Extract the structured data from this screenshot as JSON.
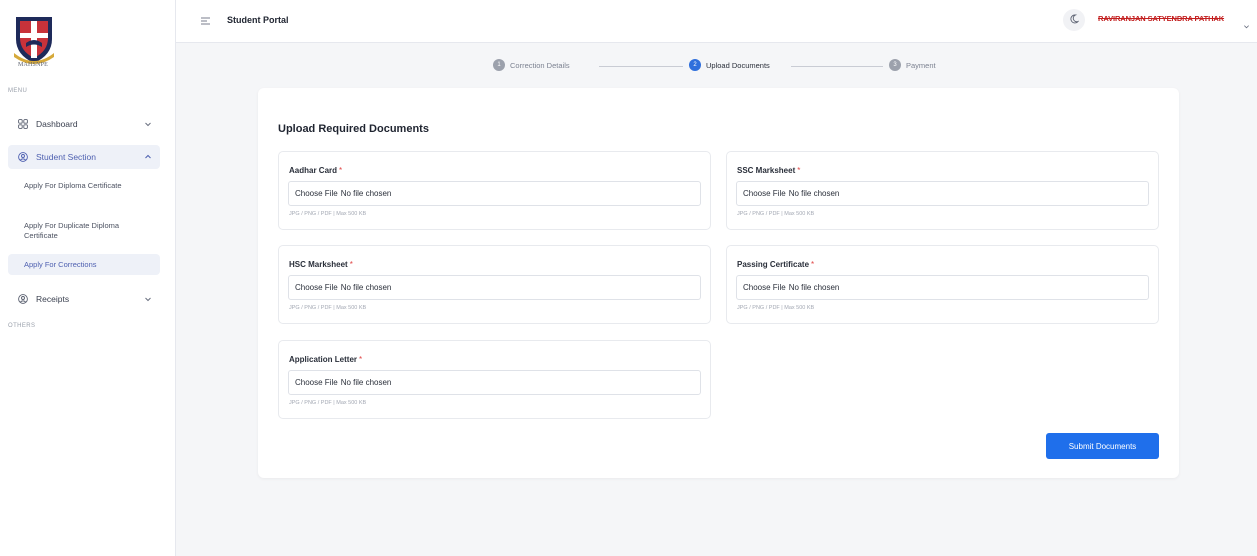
{
  "brand": {
    "logo_caption": "MAHSNPE"
  },
  "sidebar": {
    "menu_label": "MENU",
    "others_label": "OTHERS",
    "items": [
      {
        "label": "Dashboard",
        "icon": "grid-icon"
      },
      {
        "label": "Student Section",
        "icon": "user-circle-icon"
      },
      {
        "label": "Receipts",
        "icon": "receipt-icon"
      }
    ],
    "student_sub_items": [
      {
        "label": "Apply For Diploma Certificate"
      },
      {
        "label": "Apply For Duplicate Diploma Certificate"
      },
      {
        "label": "Apply For Corrections"
      }
    ]
  },
  "header": {
    "title": "Student Portal",
    "user_name": "RAVIRANJAN SATYENDRA PATHAK"
  },
  "stepper": {
    "steps": [
      {
        "number": "1",
        "label": "Correction Details"
      },
      {
        "number": "2",
        "label": "Upload Documents"
      },
      {
        "number": "3",
        "label": "Payment"
      }
    ],
    "current_step": 2
  },
  "form": {
    "title": "Upload Required Documents",
    "required_marker": "*",
    "choose_label": "Choose File",
    "no_file_label": "No file chosen",
    "hint": "JPG / PNG / PDF | Max 500 KB",
    "fields": [
      {
        "label": "Aadhar Card"
      },
      {
        "label": "SSC Marksheet"
      },
      {
        "label": "HSC Marksheet"
      },
      {
        "label": "Passing Certificate"
      },
      {
        "label": "Application Letter"
      }
    ],
    "submit_label": "Submit Documents"
  },
  "colors": {
    "accent": "#1f6feb",
    "active_nav": "#4d5fb0",
    "required": "#e04545"
  }
}
